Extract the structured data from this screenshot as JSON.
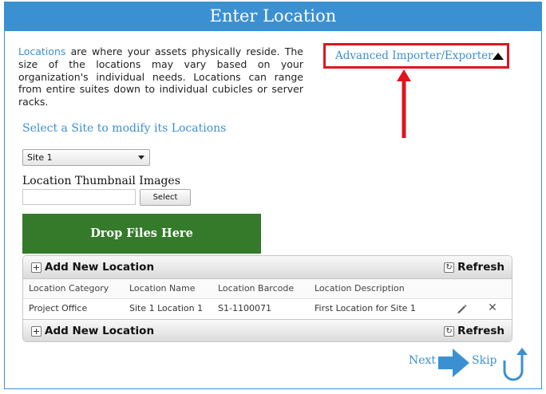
{
  "header": {
    "title": "Enter Location"
  },
  "intro": {
    "highlight": "Locations",
    "text": " are where your assets physically reside. The size of the locations may vary based on your organization's individual needs. Locations can range from entire suites down to individual cubicles or server racks."
  },
  "advanced": {
    "label": "Advanced Importer/Exporter",
    "icon": "triangle-up-icon",
    "highlight_color": "#e0141e"
  },
  "site": {
    "label": "Select a Site to modify its Locations",
    "selected": "Site 1"
  },
  "thumbnails": {
    "label": "Location Thumbnail Images",
    "input_value": "",
    "select_button": "Select"
  },
  "dropzone": {
    "label": "Drop Files Here",
    "color": "#347a2a"
  },
  "grid": {
    "add_label": "Add New Location",
    "refresh_label": "Refresh",
    "columns": [
      "Location Category",
      "Location Name",
      "Location Barcode",
      "Location Description"
    ],
    "rows": [
      {
        "category": "Project Office",
        "name": "Site 1 Location 1",
        "barcode": "S1-1100071",
        "description": "First Location for Site 1"
      }
    ]
  },
  "footer": {
    "next_label": "Next",
    "skip_label": "Skip"
  },
  "colors": {
    "accent": "#3b90d1"
  }
}
